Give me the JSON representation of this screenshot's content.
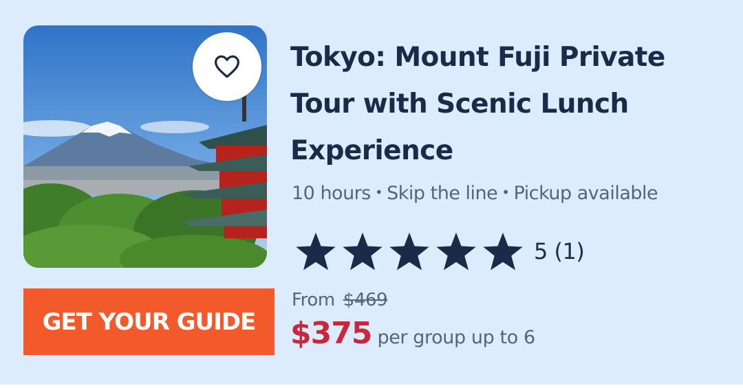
{
  "product": {
    "title": "Tokyo: Mount Fuji Private Tour with Scenic Lunch Experience",
    "meta": {
      "duration": "10 hours",
      "skip": "Skip the line",
      "pickup": "Pickup available",
      "separator": "•"
    },
    "rating": {
      "value": 5,
      "label": "5 (1)",
      "star_color": "#1a2b49"
    },
    "pricing": {
      "from_label": "From",
      "original_price": "$469",
      "price": "$375",
      "unit": "per group up to 6",
      "price_color": "#c7283d"
    },
    "image": {
      "subject": "Mount Fuji with red pagoda",
      "favorite_icon": "heart-outline-icon"
    }
  },
  "brand": {
    "name": "GET YOUR GUIDE",
    "color": "#f25a2b"
  },
  "colors": {
    "card_bg": "#dcecfc",
    "title": "#1a2b49",
    "muted": "#56647b"
  }
}
